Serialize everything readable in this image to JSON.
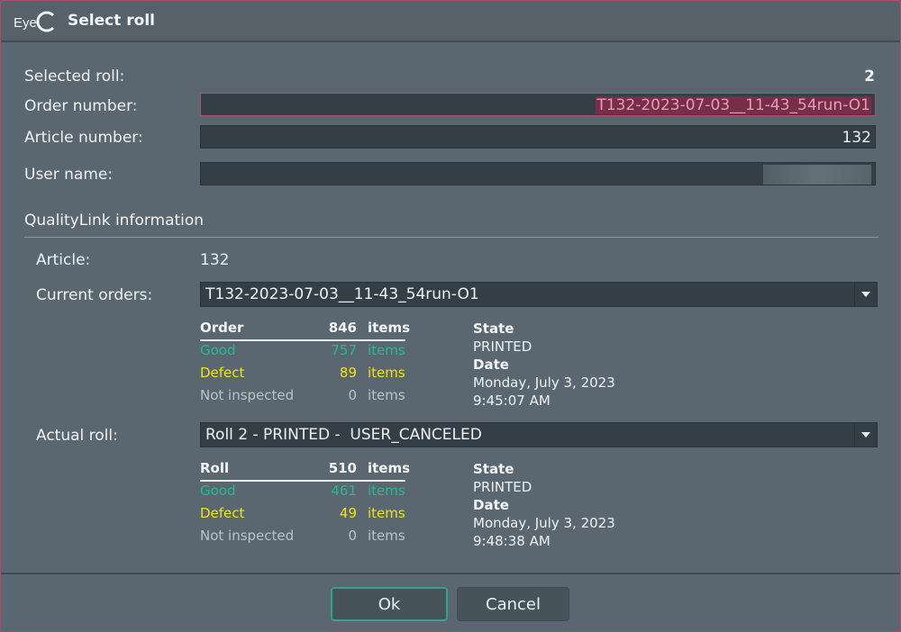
{
  "window": {
    "title": "Select roll",
    "logo_text": "EyeC"
  },
  "form": {
    "selected_roll_label": "Selected roll:",
    "selected_roll_value": "2",
    "order_number_label": "Order number:",
    "order_number_value": "T132-2023-07-03__11-43_54run-O1",
    "article_number_label": "Article number:",
    "article_number_value": "132",
    "user_name_label": "User name:",
    "user_name_value": ""
  },
  "qualitylink": {
    "title": "QualityLink information",
    "article_label": "Article:",
    "article_value": "132",
    "current_orders_label": "Current orders:",
    "current_orders_value": "T132-2023-07-03__11-43_54run-O1",
    "order_table": {
      "header": {
        "name": "Order",
        "count": "846",
        "unit": "items"
      },
      "rows": [
        {
          "name": "Good",
          "count": "757",
          "unit": "items"
        },
        {
          "name": "Defect",
          "count": "89",
          "unit": "items"
        },
        {
          "name": "Not inspected",
          "count": "0",
          "unit": "items"
        }
      ]
    },
    "order_state": {
      "state_label": "State",
      "state_value": "PRINTED",
      "date_label": "Date",
      "date_value": "Monday, July 3, 2023",
      "time_value": "9:45:07 AM"
    },
    "actual_roll_label": "Actual roll:",
    "actual_roll_value": "Roll 2 - PRINTED -  USER_CANCELED",
    "roll_table": {
      "header": {
        "name": "Roll",
        "count": "510",
        "unit": "items"
      },
      "rows": [
        {
          "name": "Good",
          "count": "461",
          "unit": "items"
        },
        {
          "name": "Defect",
          "count": "49",
          "unit": "items"
        },
        {
          "name": "Not inspected",
          "count": "0",
          "unit": "items"
        }
      ]
    },
    "roll_state": {
      "state_label": "State",
      "state_value": "PRINTED",
      "date_label": "Date",
      "date_value": "Monday, July 3, 2023",
      "time_value": "9:48:38 AM"
    }
  },
  "buttons": {
    "ok": "Ok",
    "cancel": "Cancel"
  },
  "colors": {
    "good": "#27b98e",
    "defect": "#f2e311",
    "accent": "#2fa58a",
    "error": "#b24d6e"
  }
}
